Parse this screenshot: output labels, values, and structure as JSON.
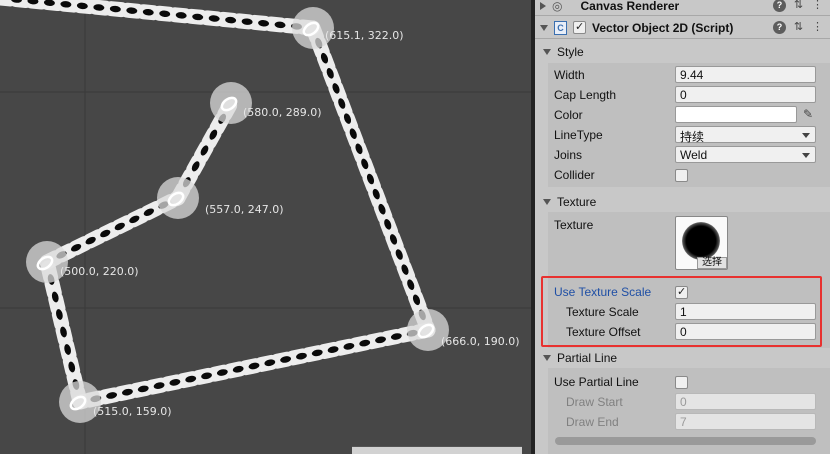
{
  "scene": {
    "points": [
      {
        "label": "(615.1, 322.0)"
      },
      {
        "label": "(580.0, 289.0)"
      },
      {
        "label": "(557.0, 247.0)"
      },
      {
        "label": "(500.0, 220.0)"
      },
      {
        "label": "(666.0, 190.0)"
      },
      {
        "label": "(515.0, 159.0)"
      }
    ]
  },
  "inspector": {
    "canvas_renderer": {
      "title": "Canvas Renderer"
    },
    "vector_object": {
      "title": "Vector Object 2D (Script)",
      "enabled": true,
      "style": {
        "section_title": "Style",
        "width": {
          "label": "Width",
          "value": "9.44"
        },
        "cap_length": {
          "label": "Cap Length",
          "value": "0"
        },
        "color": {
          "label": "Color",
          "value": "#ffffff"
        },
        "line_type": {
          "label": "LineType",
          "value": "持续"
        },
        "joins": {
          "label": "Joins",
          "value": "Weld"
        },
        "collider": {
          "label": "Collider",
          "checked": false
        }
      },
      "texture": {
        "section_title": "Texture",
        "texture": {
          "label": "Texture",
          "button": "选择"
        },
        "use_texture_scale": {
          "label": "Use Texture Scale",
          "checked": true
        },
        "texture_scale": {
          "label": "Texture Scale",
          "value": "1"
        },
        "texture_offset": {
          "label": "Texture Offset",
          "value": "0"
        }
      },
      "partial_line": {
        "section_title": "Partial Line",
        "use_partial_line": {
          "label": "Use Partial Line",
          "checked": false
        },
        "draw_start": {
          "label": "Draw Start",
          "value": "0"
        },
        "draw_end": {
          "label": "Draw End",
          "value": "7"
        }
      }
    }
  },
  "colors": {
    "scene_bg": "#474747",
    "highlight": "#e8312f",
    "link_label": "#1f4fa5"
  },
  "icons": [
    "eye-icon",
    "script-icon",
    "help-icon",
    "preset-icon",
    "menu-icon",
    "eyedropper-icon",
    "dropdown-arrow-icon"
  ]
}
